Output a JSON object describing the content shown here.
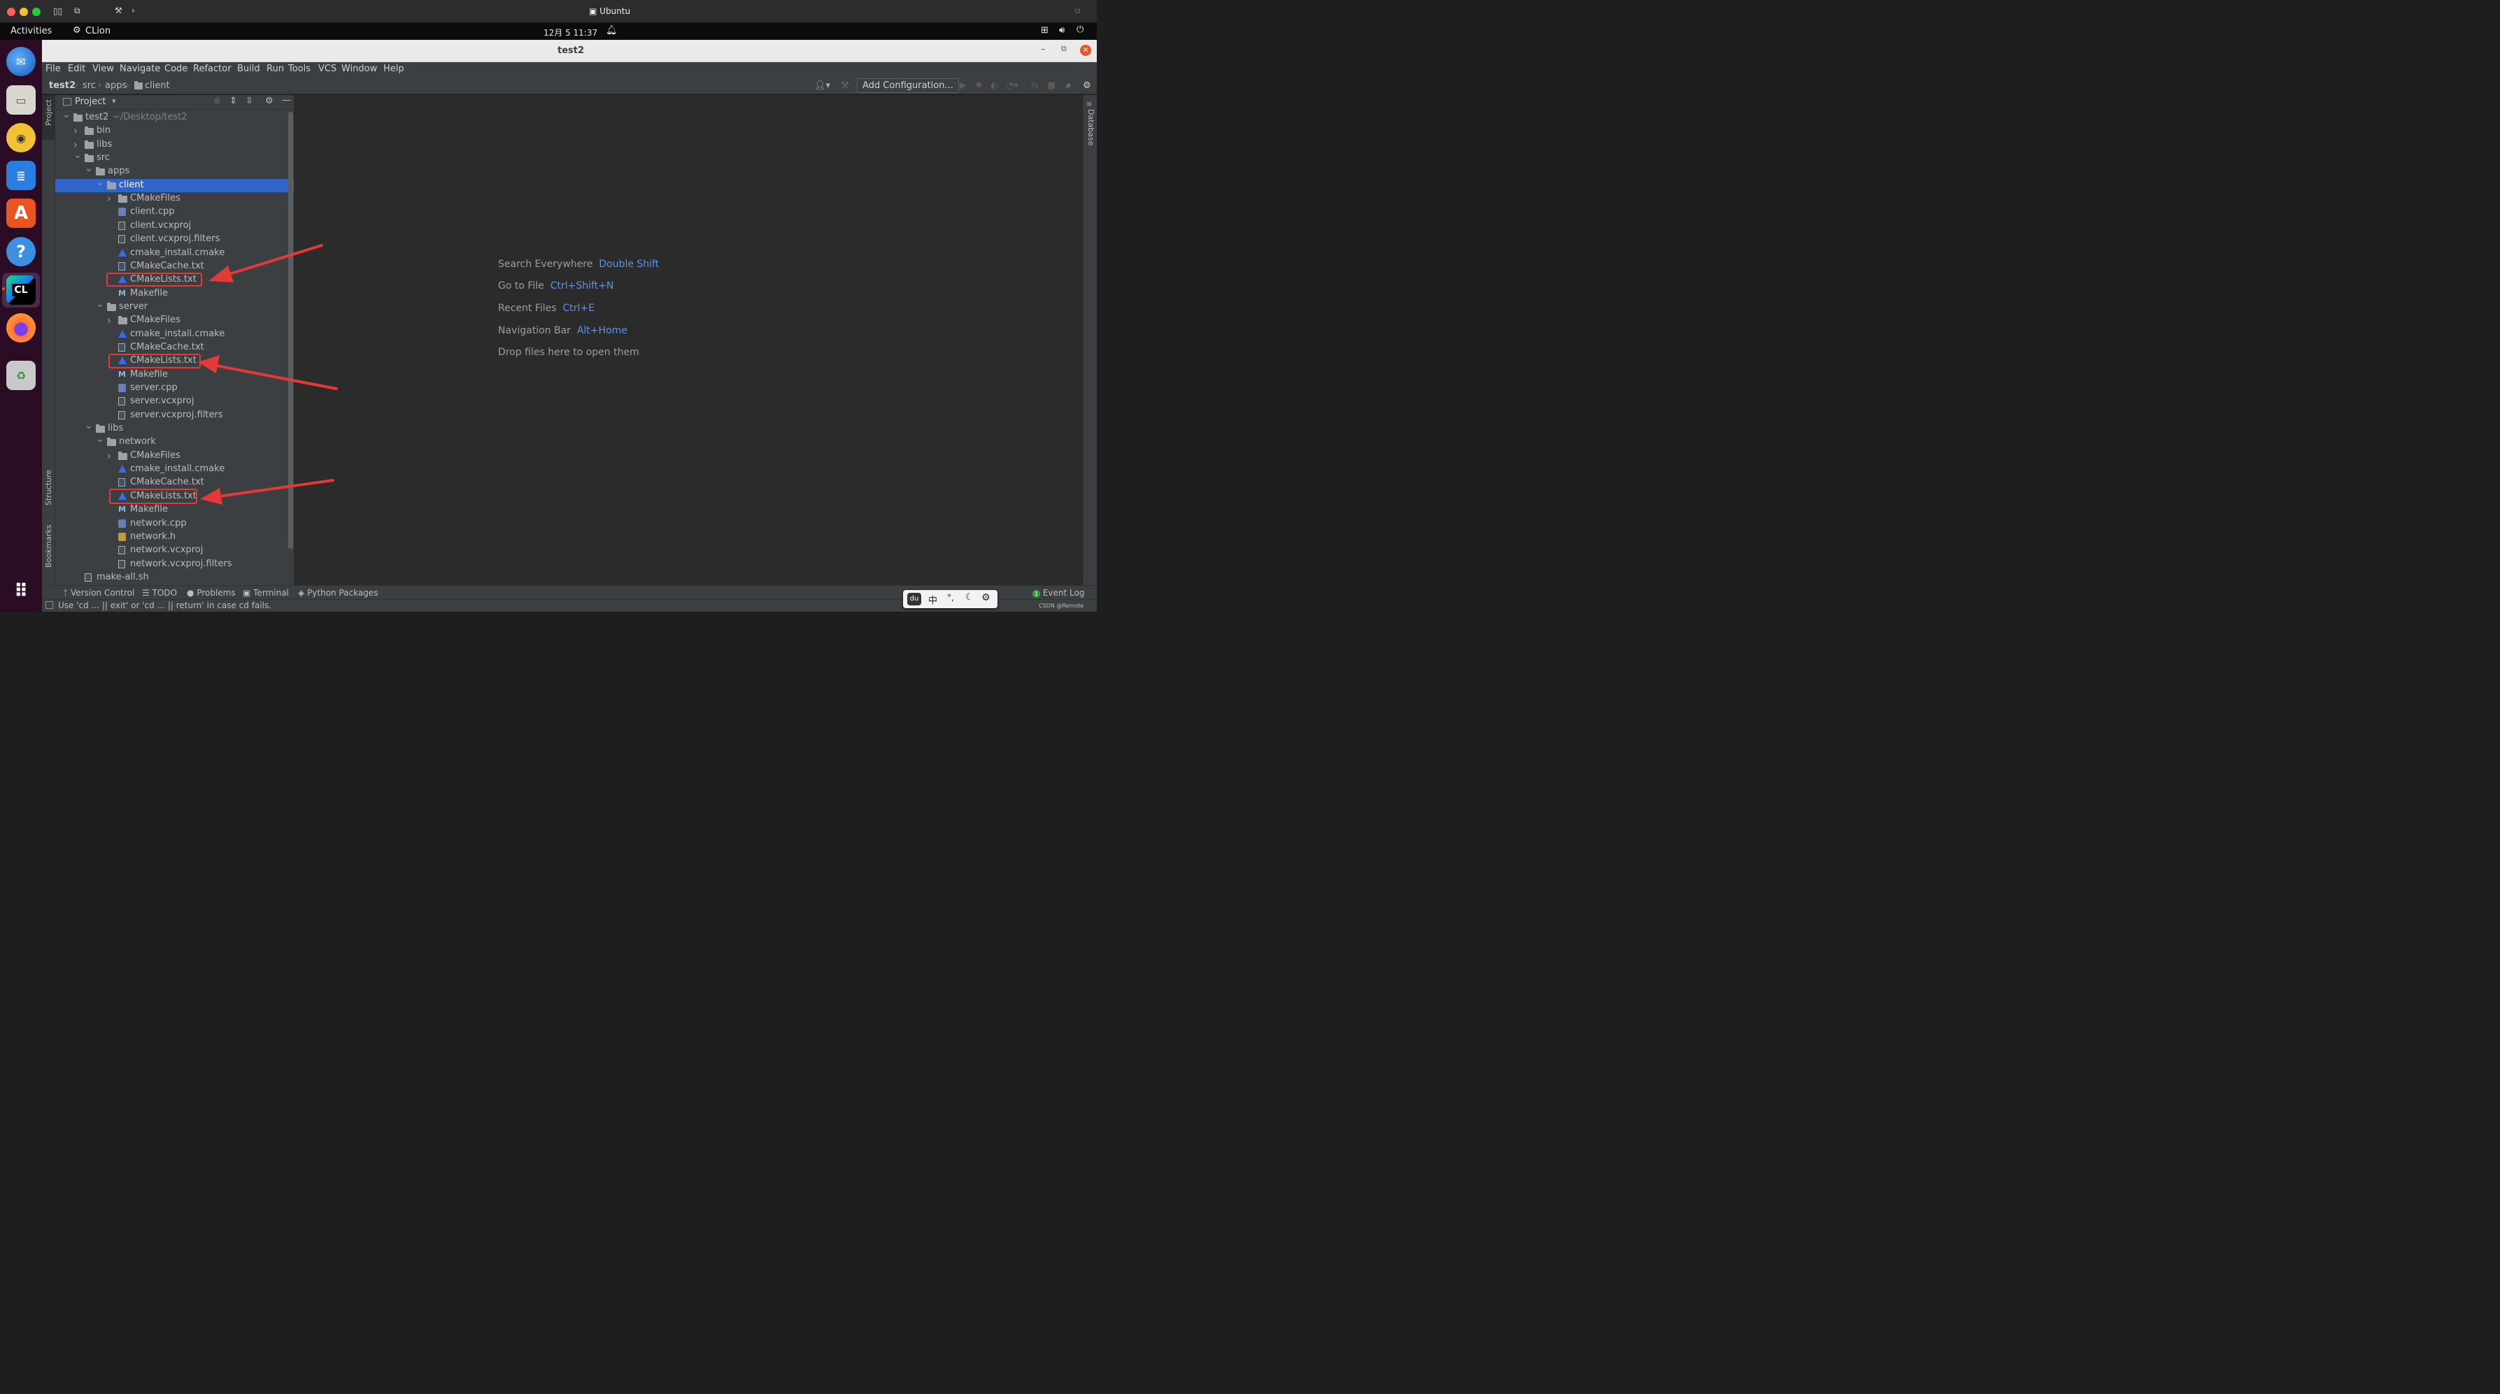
{
  "mac_window": {
    "title": "Ubuntu"
  },
  "gnome_bar": {
    "activities": "Activities",
    "app": "CLion",
    "datetime": "12月 5  11:37"
  },
  "dock": {
    "items": [
      "thunderbird-icon",
      "files-icon",
      "rhythmbox-icon",
      "writer-icon",
      "software-icon",
      "help-icon",
      "clion-icon",
      "firefox-icon",
      "trash-icon",
      "app-grid-icon"
    ],
    "clion_label": "CL"
  },
  "window": {
    "title": "test2"
  },
  "menu": {
    "items": [
      "File",
      "Edit",
      "View",
      "Navigate",
      "Code",
      "Refactor",
      "Build",
      "Run",
      "Tools",
      "VCS",
      "Window",
      "Help"
    ]
  },
  "breadcrumbs": [
    "test2",
    "src",
    "apps",
    "client"
  ],
  "run_config": {
    "label": "Add Configuration..."
  },
  "left_stripe": {
    "project": "Project",
    "structure": "Structure",
    "bookmarks": "Bookmarks"
  },
  "right_stripe": {
    "database": "Database"
  },
  "project_panel": {
    "title": "Project"
  },
  "tree": [
    {
      "label": "test2",
      "path": "~/Desktop/test2",
      "depth": 0,
      "kind": "folder",
      "expanded": true
    },
    {
      "label": "bin",
      "depth": 1,
      "kind": "folder",
      "expanded": false
    },
    {
      "label": "libs",
      "depth": 1,
      "kind": "folder",
      "expanded": false
    },
    {
      "label": "src",
      "depth": 1,
      "kind": "folder",
      "expanded": true
    },
    {
      "label": "apps",
      "depth": 2,
      "kind": "folder",
      "expanded": true
    },
    {
      "label": "client",
      "depth": 3,
      "kind": "folder",
      "expanded": true,
      "selected": true
    },
    {
      "label": "CMakeFiles",
      "depth": 4,
      "kind": "folder",
      "expanded": false
    },
    {
      "label": "client.cpp",
      "depth": 4,
      "kind": "cpp"
    },
    {
      "label": "client.vcxproj",
      "depth": 4,
      "kind": "file"
    },
    {
      "label": "client.vcxproj.filters",
      "depth": 4,
      "kind": "file"
    },
    {
      "label": "cmake_install.cmake",
      "depth": 4,
      "kind": "cmake"
    },
    {
      "label": "CMakeCache.txt",
      "depth": 4,
      "kind": "cache"
    },
    {
      "label": "CMakeLists.txt",
      "depth": 4,
      "kind": "cmake",
      "highlighted": true
    },
    {
      "label": "Makefile",
      "depth": 4,
      "kind": "make"
    },
    {
      "label": "server",
      "depth": 3,
      "kind": "folder",
      "expanded": true
    },
    {
      "label": "CMakeFiles",
      "depth": 4,
      "kind": "folder",
      "expanded": false
    },
    {
      "label": "cmake_install.cmake",
      "depth": 4,
      "kind": "cmake"
    },
    {
      "label": "CMakeCache.txt",
      "depth": 4,
      "kind": "cache"
    },
    {
      "label": "CMakeLists.txt",
      "depth": 4,
      "kind": "cmake",
      "highlighted": true
    },
    {
      "label": "Makefile",
      "depth": 4,
      "kind": "make"
    },
    {
      "label": "server.cpp",
      "depth": 4,
      "kind": "cpp"
    },
    {
      "label": "server.vcxproj",
      "depth": 4,
      "kind": "file"
    },
    {
      "label": "server.vcxproj.filters",
      "depth": 4,
      "kind": "file"
    },
    {
      "label": "libs",
      "depth": 2,
      "kind": "folder",
      "expanded": true
    },
    {
      "label": "network",
      "depth": 3,
      "kind": "folder",
      "expanded": true
    },
    {
      "label": "CMakeFiles",
      "depth": 4,
      "kind": "folder",
      "expanded": false
    },
    {
      "label": "cmake_install.cmake",
      "depth": 4,
      "kind": "cmake"
    },
    {
      "label": "CMakeCache.txt",
      "depth": 4,
      "kind": "cache"
    },
    {
      "label": "CMakeLists.txt",
      "depth": 4,
      "kind": "cmake",
      "highlighted": true
    },
    {
      "label": "Makefile",
      "depth": 4,
      "kind": "make"
    },
    {
      "label": "network.cpp",
      "depth": 4,
      "kind": "cpp"
    },
    {
      "label": "network.h",
      "depth": 4,
      "kind": "header"
    },
    {
      "label": "network.vcxproj",
      "depth": 4,
      "kind": "file"
    },
    {
      "label": "network.vcxproj.filters",
      "depth": 4,
      "kind": "file"
    },
    {
      "label": "make-all.sh",
      "depth": 1,
      "kind": "script"
    }
  ],
  "editor_hints": [
    {
      "text": "Search Everywhere",
      "key": "Double Shift"
    },
    {
      "text": "Go to File",
      "key": "Ctrl+Shift+N"
    },
    {
      "text": "Recent Files",
      "key": "Ctrl+E"
    },
    {
      "text": "Navigation Bar",
      "key": "Alt+Home"
    },
    {
      "text": "Drop files here to open them",
      "key": ""
    }
  ],
  "bottom_tools": [
    "Version Control",
    "TODO",
    "Problems",
    "Terminal",
    "Python Packages"
  ],
  "event_log": {
    "label": "Event Log",
    "count": "1"
  },
  "ime": {
    "items": [
      "du",
      "中",
      "°,",
      "moon-icon",
      "gear-icon"
    ]
  },
  "status": {
    "message": "Use 'cd ... || exit' or 'cd ... || return' in case cd fails.",
    "watermark": "CSDN @Remote"
  },
  "colors": {
    "selection": "#2f65ca",
    "annotation": "#e53935",
    "link": "#5c93e6"
  }
}
